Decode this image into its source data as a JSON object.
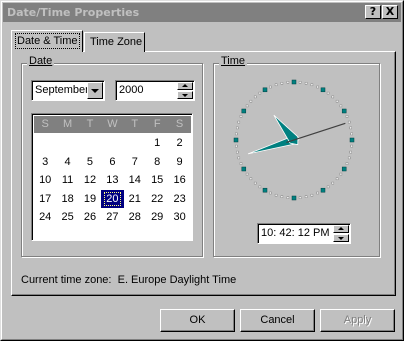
{
  "window": {
    "title": "Date/Time Properties",
    "help_button": "?",
    "close_button": "X"
  },
  "tabs": [
    {
      "label": "Date & Time",
      "active": true
    },
    {
      "label": "Time Zone",
      "active": false
    }
  ],
  "date_group": {
    "label": "Date",
    "month": "September",
    "year": "2000",
    "weekday_headers": [
      "S",
      "M",
      "T",
      "W",
      "T",
      "F",
      "S"
    ],
    "days": [
      [
        "",
        "",
        "",
        "",
        "",
        "1",
        "2"
      ],
      [
        "3",
        "4",
        "5",
        "6",
        "7",
        "8",
        "9"
      ],
      [
        "10",
        "11",
        "12",
        "13",
        "14",
        "15",
        "16"
      ],
      [
        "17",
        "18",
        "19",
        "20",
        "21",
        "22",
        "23"
      ],
      [
        "24",
        "25",
        "26",
        "27",
        "28",
        "29",
        "30"
      ]
    ],
    "selected_day": "20"
  },
  "time_group": {
    "label": "Time",
    "time_value": "10: 42: 12 PM",
    "clock": {
      "hour": 10,
      "minute": 42,
      "second": 12,
      "hand_color": "#008080"
    }
  },
  "timezone": {
    "label": "Current time zone:",
    "value": "E. Europe Daylight Time"
  },
  "buttons": {
    "ok": "OK",
    "cancel": "Cancel",
    "apply": "Apply"
  }
}
